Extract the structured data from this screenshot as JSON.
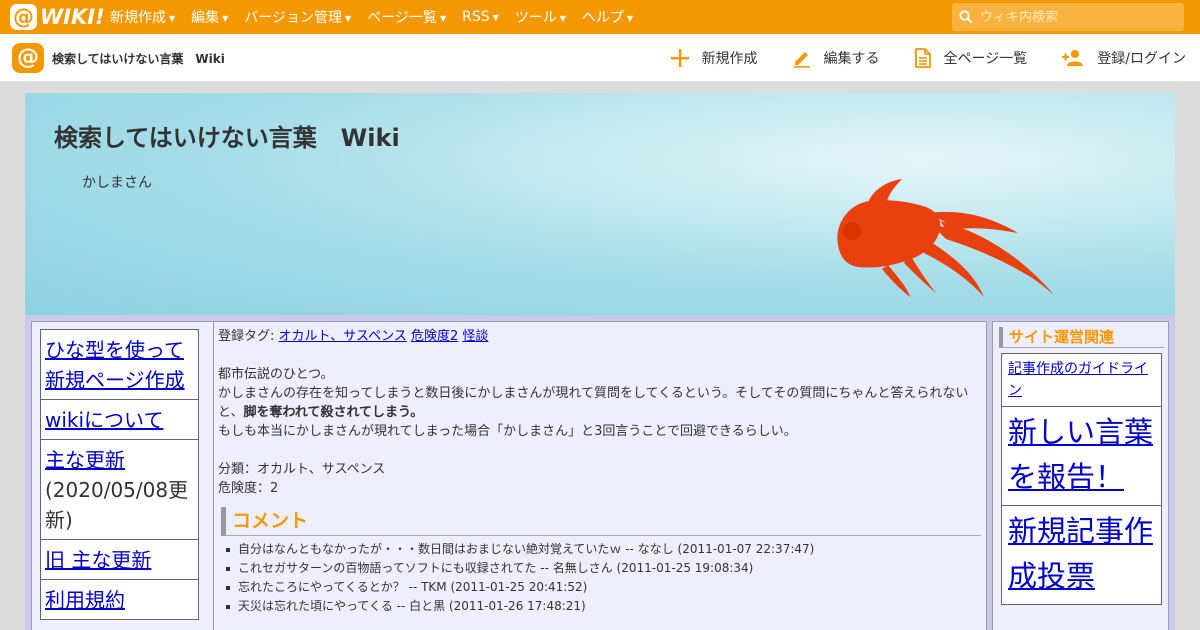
{
  "topbar": {
    "logo_text": "WIKI!",
    "menu": [
      {
        "label": "新規作成"
      },
      {
        "label": "編集"
      },
      {
        "label": "バージョン管理"
      },
      {
        "label": "ページ一覧"
      },
      {
        "label": "RSS"
      },
      {
        "label": "ツール"
      },
      {
        "label": "ヘルプ"
      }
    ],
    "search_placeholder": "ウィキ内検索"
  },
  "subbar": {
    "site_name": "検索してはいけない言葉　Wiki",
    "actions": {
      "new": "新規作成",
      "edit": "編集する",
      "all_pages": "全ページ一覧",
      "login": "登録/ログイン"
    }
  },
  "banner": {
    "title": "検索してはいけない言葉　Wiki",
    "subtitle": "かしまさん"
  },
  "left_menu": {
    "items": [
      {
        "label": "ひな型を使って新規ページ作成"
      },
      {
        "label": "wikiについて"
      },
      {
        "label": "主な更新",
        "sub": "(2020/05/08更新)"
      },
      {
        "label": "旧 主な更新"
      },
      {
        "label": "利用規約"
      }
    ]
  },
  "article": {
    "tags_label": "登録タグ:",
    "tags": [
      "オカルト、サスペンス",
      "危険度2",
      "怪談"
    ],
    "line1": "都市伝説のひとつ。",
    "line2": "かしまさんの存在を知ってしまうと数日後にかしまさんが現れて質問をしてくるという。そしてその質問にちゃんと答えられないと、",
    "line2_bold": "脚を奪われて殺されてしまう。",
    "line3": "もしも本当にかしまさんが現れてしまった場合「かしまさん」と3回言うことで回避できるらしい。",
    "category": "分類：オカルト、サスペンス",
    "danger": "危険度：2",
    "comments_heading": "コメント",
    "comments": [
      "自分はなんともなかったが・・・数日間はおまじない絶対覚えていたｗ -- ななし (2011-01-07 22:37:47)",
      "これセガサターンの百物語ってソフトにも収録されてた -- 名無しさん (2011-01-25 19:08:34)",
      "忘れたころにやってくるとか？ -- TKM (2011-01-25 20:41:52)",
      "天災は忘れた頃にやってくる -- 白と黒 (2011-01-26 17:48:21)"
    ]
  },
  "right_menu": {
    "heading": "サイト運営関連",
    "items": [
      {
        "label": "記事作成のガイドライン"
      },
      {
        "label": "新しい言葉を報告！"
      },
      {
        "label": "新規記事作成投票"
      }
    ]
  },
  "colors": {
    "brand_orange": "#f39800",
    "link_blue": "#0000cc",
    "panel_bg": "#eeeeff",
    "fish": "#e8400f"
  },
  "icons": [
    "search-icon",
    "plus-icon",
    "pencil-icon",
    "document-icon",
    "add-user-icon",
    "goldfish-image"
  ]
}
